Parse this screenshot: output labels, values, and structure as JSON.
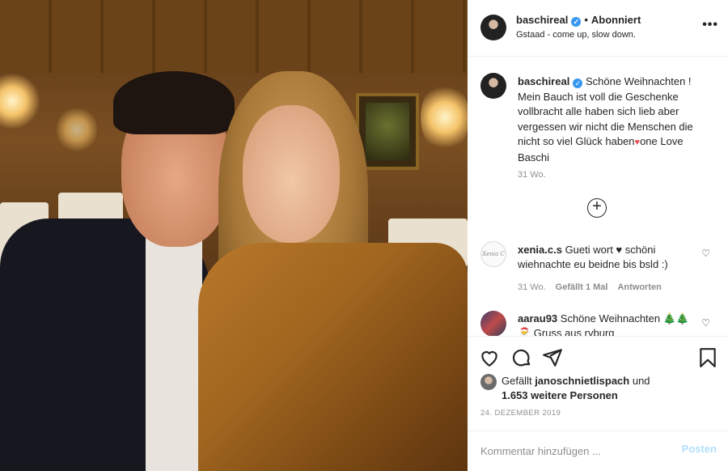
{
  "header": {
    "username": "baschireal",
    "follow_label": "Abonniert",
    "separator": "•",
    "location": "Gstaad - come up, slow down.",
    "more_label": "•••"
  },
  "caption": {
    "username": "baschireal",
    "text": "Schöne Weihnachten ! Mein Bauch ist voll die Geschenke vollbracht alle haben sich lieb aber vergessen wir nicht die Menschen die nicht so viel Glück haben",
    "heart": "♥",
    "text_end": "one Love Baschi",
    "time": "31 Wo."
  },
  "load_more": {
    "label": "+"
  },
  "comments": [
    {
      "username": "xenia.c.s",
      "avatar_text": "Xenia C",
      "text": "Gueti wort ♥ schöni wiehnachte eu beidne bis bsld :)",
      "time": "31 Wo.",
      "likes": "Gefällt 1 Mal",
      "reply": "Antworten"
    },
    {
      "username": "aarau93",
      "text": "Schöne Weihnachten 🎄🎄🎅 Gruss aus ryburg"
    }
  ],
  "likes": {
    "prefix": "Gefällt ",
    "user": "janoschnietlispach",
    "middle": " und",
    "count": "1.653 weitere Personen"
  },
  "date": "24. DEZEMBER 2019",
  "add_comment": {
    "placeholder": "Kommentar hinzufügen ...",
    "post_label": "Posten"
  },
  "icons": [
    "heart-icon",
    "comment-icon",
    "share-icon",
    "bookmark-icon",
    "verified-icon",
    "more-icon",
    "add-icon"
  ],
  "colors": {
    "link": "#3897f0",
    "post_disabled": "#b2dffc",
    "muted": "#8e8e8e",
    "heart": "#ed4956"
  }
}
